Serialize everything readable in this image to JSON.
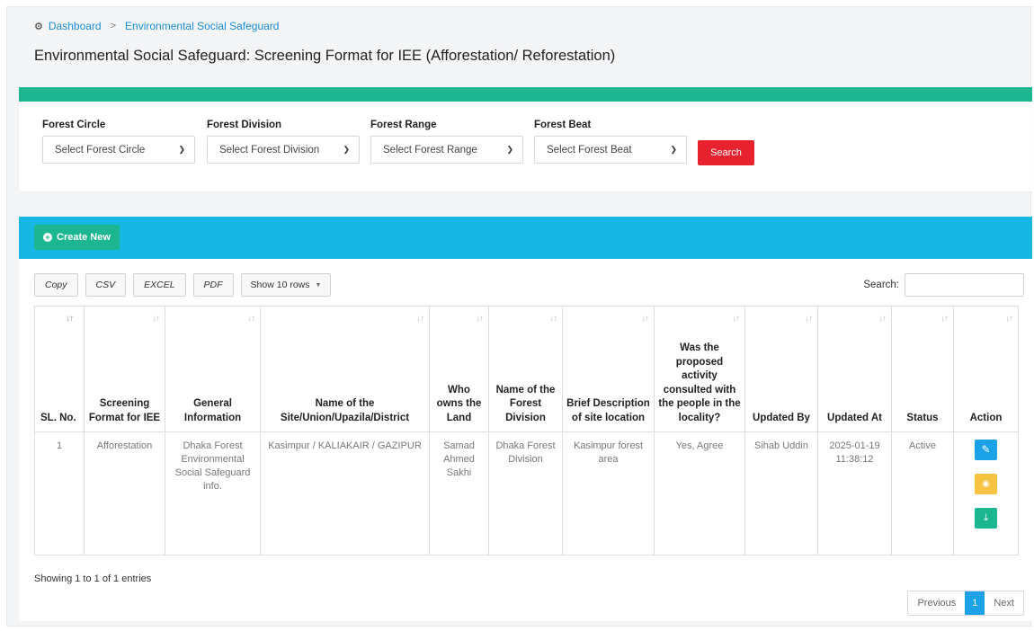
{
  "breadcrumb": {
    "home": "Dashboard",
    "current": "Environmental Social Safeguard"
  },
  "page_title": "Environmental Social Safeguard: Screening Format for IEE (Afforestation/ Reforestation)",
  "filters": [
    {
      "label": "Forest Circle",
      "placeholder": "Select Forest Circle"
    },
    {
      "label": "Forest Division",
      "placeholder": "Select Forest Division"
    },
    {
      "label": "Forest Range",
      "placeholder": "Select Forest Range"
    },
    {
      "label": "Forest Beat",
      "placeholder": "Select Forest Beat"
    }
  ],
  "search_button": "Search",
  "create_button": "Create New",
  "tools": {
    "copy": "Copy",
    "csv": "CSV",
    "excel": "EXCEL",
    "pdf": "PDF",
    "rows": "Show 10 rows"
  },
  "search_label": "Search:",
  "columns": [
    "SL. No.",
    "Screening Format for IEE",
    "General Information",
    "Name of the Site/Union/Upazila/District",
    "Who owns the Land",
    "Name of the Forest Division",
    "Brief Description of site location",
    "Was the proposed activity consulted with the people in the locality?",
    "Updated By",
    "Updated At",
    "Status",
    "Action"
  ],
  "rows": [
    {
      "sl": "1",
      "format": "Afforestation",
      "general": "Dhaka Forest Environmental Social Safeguard info.",
      "site": "Kasimpur / KALIAKAIR / GAZIPUR",
      "owner": "Samad Ahmed Sakhi",
      "division": "Dhaka Forest Division",
      "description": "Kasimpur forest area",
      "consulted": "Yes, Agree",
      "updated_by": "Sihab Uddin",
      "updated_at": "2025-01-19 11:38:12",
      "status": "Active"
    }
  ],
  "showing": "Showing 1 to 1 of 1 entries",
  "pager": {
    "previous": "Previous",
    "page": "1",
    "next": "Next"
  },
  "colors": {
    "green": "#1cb690",
    "blue_bar": "#17b7e3",
    "red": "#e8212f",
    "edit": "#1aa1e6",
    "view": "#f5c242"
  }
}
